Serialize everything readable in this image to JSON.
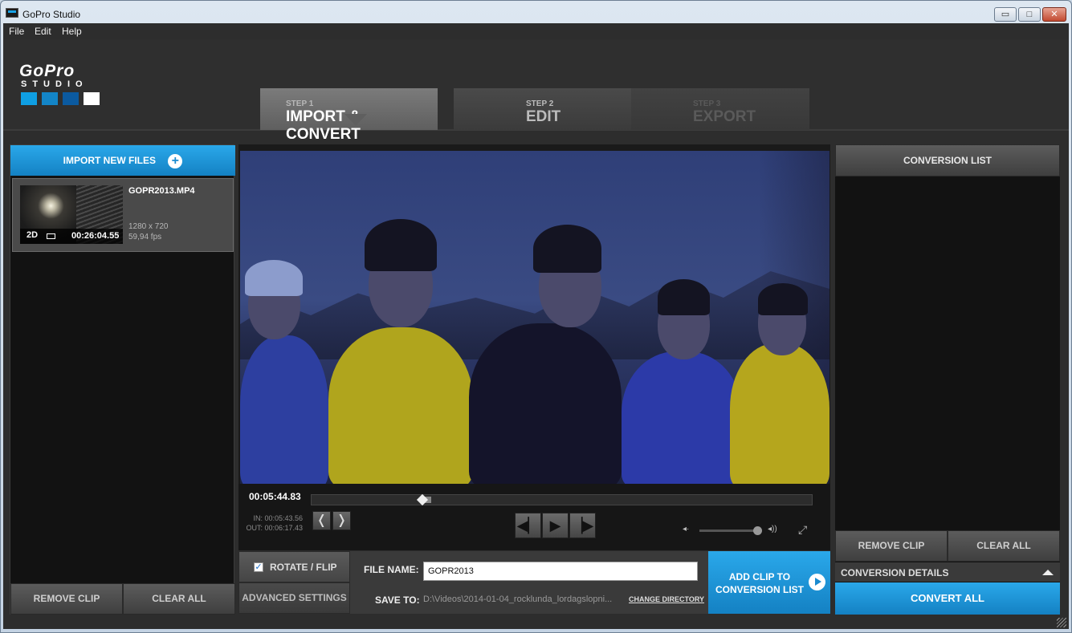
{
  "window": {
    "title": "GoPro Studio",
    "min": "▭",
    "max": "□",
    "close": "✕"
  },
  "menu": [
    "File",
    "Edit",
    "Help"
  ],
  "logo": {
    "top": "GoPro",
    "bottom": "STUDIO",
    "squares": [
      "#0f9fe3",
      "#1385c7",
      "#0b5aa0",
      "#ffffff"
    ]
  },
  "steps": [
    {
      "step": "STEP 1",
      "name": "IMPORT & CONVERT"
    },
    {
      "step": "STEP 2",
      "name": "EDIT"
    },
    {
      "step": "STEP 3",
      "name": "EXPORT"
    }
  ],
  "left": {
    "import_label": "IMPORT NEW FILES",
    "clip": {
      "filename": "GOPR2013.MP4",
      "badge": "2D",
      "duration": "00:26:04.55",
      "resolution": "1280 x 720",
      "fps": "59,94 fps"
    },
    "remove_label": "REMOVE CLIP",
    "clear_label": "CLEAR ALL"
  },
  "player": {
    "timecode": "00:05:44.83",
    "in_point": "IN: 00:05:43.56",
    "out_point": "OUT: 00:06:17.43",
    "volume_level": 0.88
  },
  "bottom": {
    "rotate_label": "ROTATE / FLIP",
    "rotate_checked": true,
    "advanced_label": "ADVANCED SETTINGS",
    "filename_label": "FILE NAME:",
    "filename_value": "GOPR2013",
    "saveto_label": "SAVE TO:",
    "saveto_value": "D:\\Videos\\2014-01-04_rocklunda_lordagslopni...",
    "change_dir_label": "CHANGE DIRECTORY",
    "add_clip_label_1": "ADD CLIP TO",
    "add_clip_label_2": "CONVERSION LIST"
  },
  "right": {
    "title": "CONVERSION LIST",
    "remove_label": "REMOVE CLIP",
    "clear_label": "CLEAR ALL",
    "details_label": "CONVERSION DETAILS",
    "convert_label": "CONVERT ALL"
  },
  "colors": {
    "accent": "#1a94d8"
  }
}
